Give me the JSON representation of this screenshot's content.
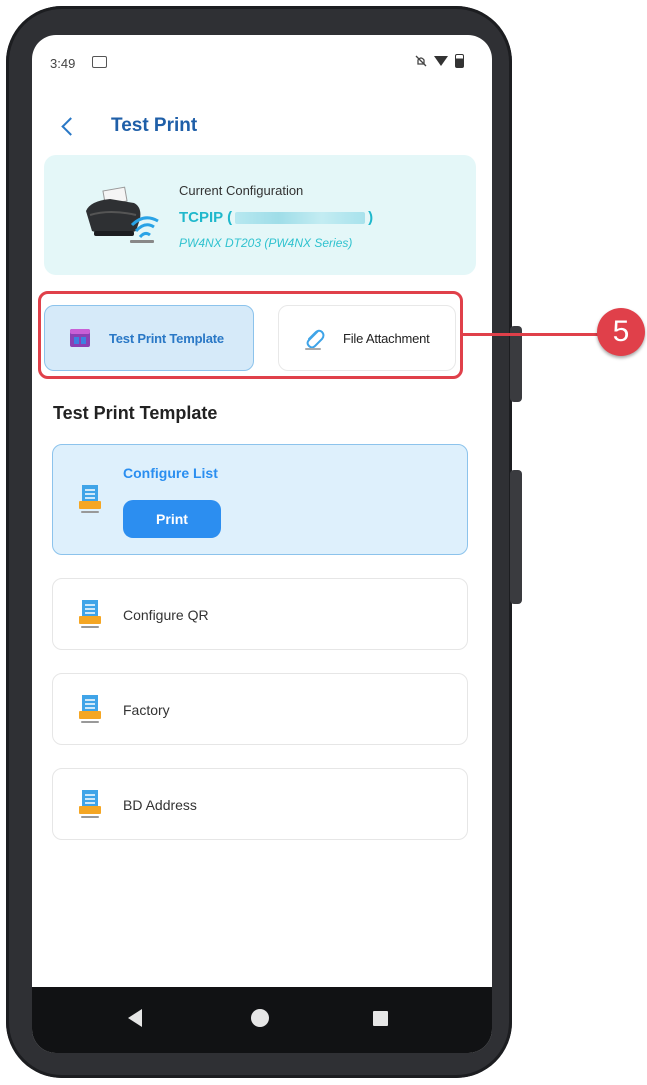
{
  "status_bar": {
    "time": "3:49"
  },
  "header": {
    "title": "Test Print"
  },
  "config": {
    "label": "Current Configuration",
    "connection_prefix": "TCPIP (",
    "connection_suffix": ")",
    "model": "PW4NX DT203 (PW4NX Series)"
  },
  "tabs": [
    {
      "label": "Test Print Template",
      "icon": "template-icon",
      "selected": true
    },
    {
      "label": "File Attachment",
      "icon": "paperclip-icon",
      "selected": false
    }
  ],
  "callout": {
    "number": "5"
  },
  "section": {
    "title": "Test Print Template"
  },
  "templates": [
    {
      "label": "Configure List",
      "selected": true
    },
    {
      "label": "Configure QR",
      "selected": false
    },
    {
      "label": "Factory",
      "selected": false
    },
    {
      "label": "BD Address",
      "selected": false
    }
  ],
  "print_button": {
    "label": "Print"
  },
  "colors": {
    "accent": "#2c8ef0",
    "header_blue": "#1f5fa8",
    "teal": "#1fb8cc",
    "callout_red": "#e0404a"
  }
}
